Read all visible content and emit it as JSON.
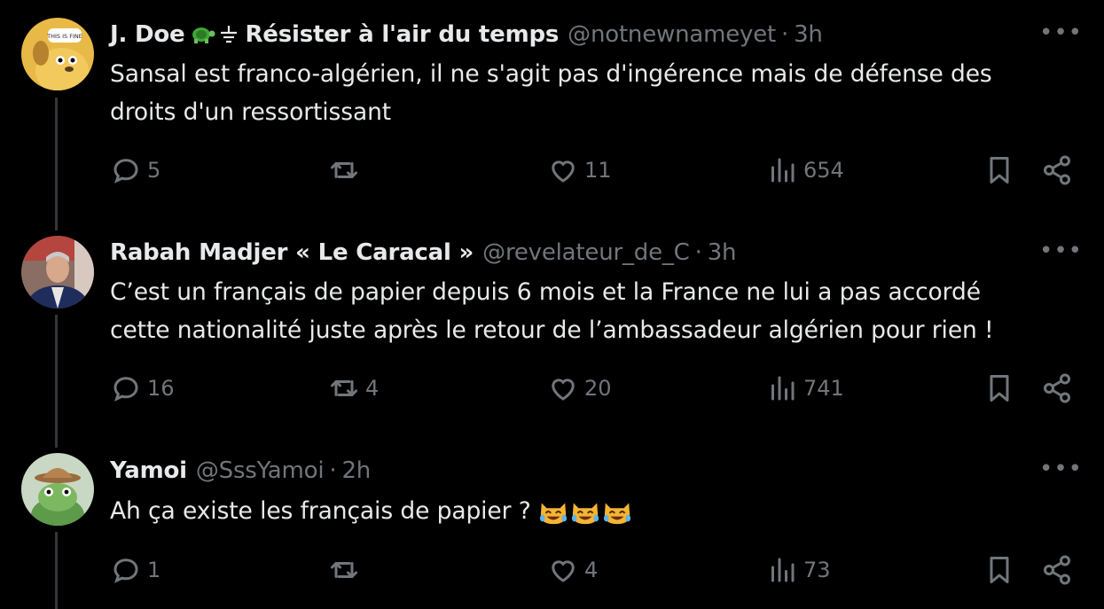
{
  "tweets": [
    {
      "name": "J. Doe",
      "badges": "🐢⏚",
      "name_suffix": "Résister à l'air du temps",
      "handle": "@notnewnameyet",
      "time": "3h",
      "text_line1": "Sansal est franco-algérien, il ne s'agit pas d'ingérence mais de défense des",
      "text_line2": "droits d'un ressortissant",
      "replies": "5",
      "retweets": "",
      "likes": "11",
      "views": "654",
      "avatar_caption": "THIS IS FINE"
    },
    {
      "name": "Rabah Madjer « Le Caracal »",
      "handle": "@revelateur_de_C",
      "time": "3h",
      "text_line1": "C’est un français de papier depuis 6 mois et la France ne lui a pas accordé",
      "text_line2": "cette nationalité juste après le retour de l’ambassadeur algérien pour rien !",
      "replies": "16",
      "retweets": "4",
      "likes": "20",
      "views": "741"
    },
    {
      "name": "Yamoi",
      "handle": "@SssYamoi",
      "time": "2h",
      "text_line1": "Ah ça existe les français de papier ?",
      "replies": "1",
      "retweets": "",
      "likes": "4",
      "views": "73"
    }
  ],
  "more_label": "•••",
  "separator": "·",
  "colors": {
    "background": "#000000",
    "text": "#e7e9ea",
    "muted": "#71767b",
    "line": "#333639"
  },
  "icons": [
    "reply-icon",
    "retweet-icon",
    "like-icon",
    "views-icon",
    "bookmark-icon",
    "share-icon",
    "more-icon",
    "turtle-icon",
    "ground-icon",
    "laughing-cat-icon"
  ]
}
